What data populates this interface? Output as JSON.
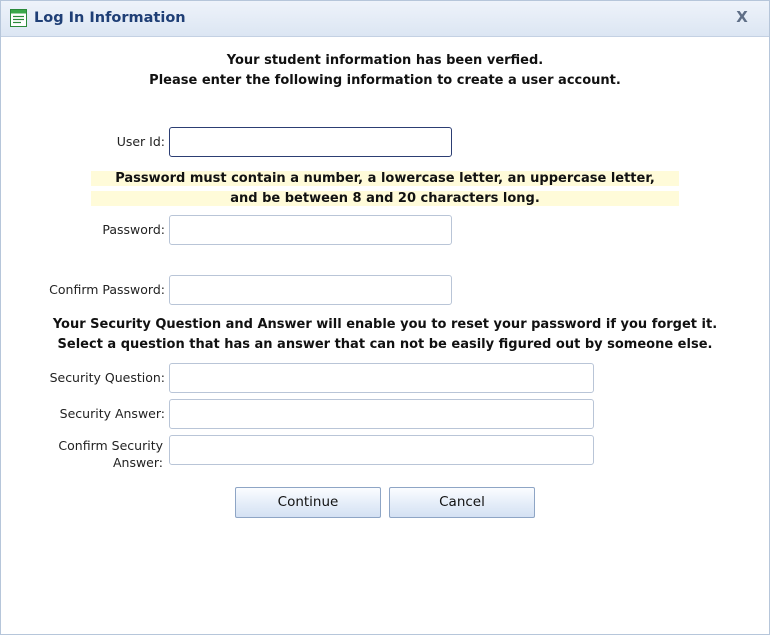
{
  "window": {
    "title": "Log In Information",
    "close_label": "X"
  },
  "intro": {
    "line1": "Your student information has been verfied.",
    "line2": "Please enter the following information to create a user account."
  },
  "password_rule": {
    "line1": "Password must contain a number, a lowercase letter, an uppercase letter,",
    "line2": "and be between 8 and 20 characters long."
  },
  "security_note": {
    "line1": "Your Security Question and Answer will enable you to reset your password if you forget it.",
    "line2": "Select a question that has an answer that can not be easily figured out by someone else."
  },
  "fields": {
    "user_id": {
      "label": "User Id:",
      "value": ""
    },
    "password": {
      "label": "Password:",
      "value": ""
    },
    "confirm_password": {
      "label": "Confirm Password:",
      "value": ""
    },
    "security_question": {
      "label": "Security Question:",
      "value": ""
    },
    "security_answer": {
      "label": "Security Answer:",
      "value": ""
    },
    "confirm_security_answer": {
      "label": "Confirm Security Answer:",
      "value": ""
    }
  },
  "buttons": {
    "continue_label": "Continue",
    "cancel_label": "Cancel"
  },
  "icons": {
    "title": "form-document-icon"
  },
  "colors": {
    "title_text": "#1f3f76",
    "titlebar_bg": "#dce6f3",
    "highlight_bg": "#fffbd9",
    "focused_border": "#2c3e73"
  }
}
